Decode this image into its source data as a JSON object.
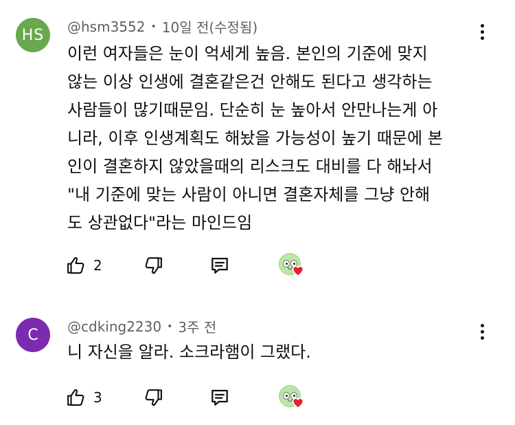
{
  "comments": [
    {
      "avatar_initials": "HS",
      "handle": "@hsm3552",
      "separator": "•",
      "time": "10일 전(수정됨)",
      "lines": [
        "이런 여자들은 눈이 억세게 높음. 본인의 기준에 맞지",
        "않는 이상 인생에 결혼같은건 안해도 된다고 생각하는",
        "사람들이 많기때문임. 단순히 눈 높아서 안만나는게 아",
        "니라, 이후 인생계획도 해놨을 가능성이 높기 때문에 본",
        "인이 결혼하지 않았을때의 리스크도 대비를 다 해놔서",
        "\"내 기준에 맞는 사람이 아니면 결혼자체를 그냥 안해",
        "도 상관없다\"라는 마인드임"
      ],
      "like_count": "2",
      "avatar_color": "#6aa84f"
    },
    {
      "avatar_initials": "C",
      "handle": "@cdking2230",
      "separator": "•",
      "time": "3주 전",
      "lines": [
        "니 자신을 알라. 소크라햄이 그랬다."
      ],
      "like_count": "3",
      "avatar_color": "#7b2bb0"
    }
  ],
  "icons": {
    "like": "thumbs-up-icon",
    "dislike": "thumbs-down-icon",
    "reply": "reply-comment-icon",
    "creator_heart": "creator-heart-badge",
    "more": "more-vertical-icon"
  },
  "colors": {
    "meta_text": "#606060",
    "body_text": "#0f0f0f",
    "heart": "#e8202f"
  }
}
